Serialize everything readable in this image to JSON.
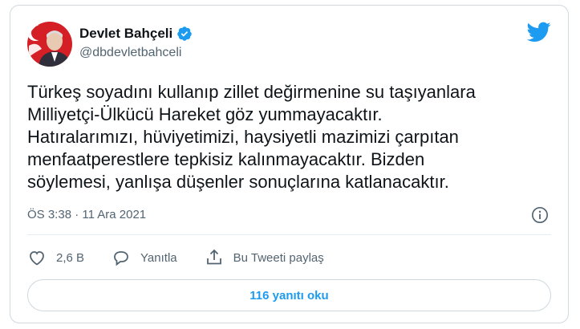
{
  "author": {
    "name": "Devlet Bahçeli",
    "handle": "@dbdevletbahceli",
    "verified": true
  },
  "tweet": {
    "text": "Türkeş soyadını kullanıp zillet değirmenine su taşıyanlara\nMilliyetçi-Ülkücü Hareket göz yummayacaktır.\nHatıralarımızı, hüviyetimizi, haysiyetli mazimizi çarpıtan\nmenfaatperestlere tepkisiz kalınmayacaktır. Bizden\nsöylemesi, yanlışa düşenler sonuçlarına katlanacaktır.",
    "timestamp": "ÖS 3:38 · 11 Ara 2021"
  },
  "actions": {
    "like_count": "2,6 B",
    "reply_label": "Yanıtla",
    "share_label": "Bu Tweeti paylaş"
  },
  "replies_button": "116 yanıtı oku",
  "icons": {
    "verified": "verified-badge-icon",
    "bird": "twitter-bird-icon",
    "info": "info-icon",
    "like": "heart-icon",
    "reply": "speech-bubble-icon",
    "share": "share-arrow-icon"
  },
  "colors": {
    "accent": "#1d9bf0",
    "secondary_text": "#536471",
    "primary_text": "#0f1419",
    "border": "#cfd9de"
  }
}
